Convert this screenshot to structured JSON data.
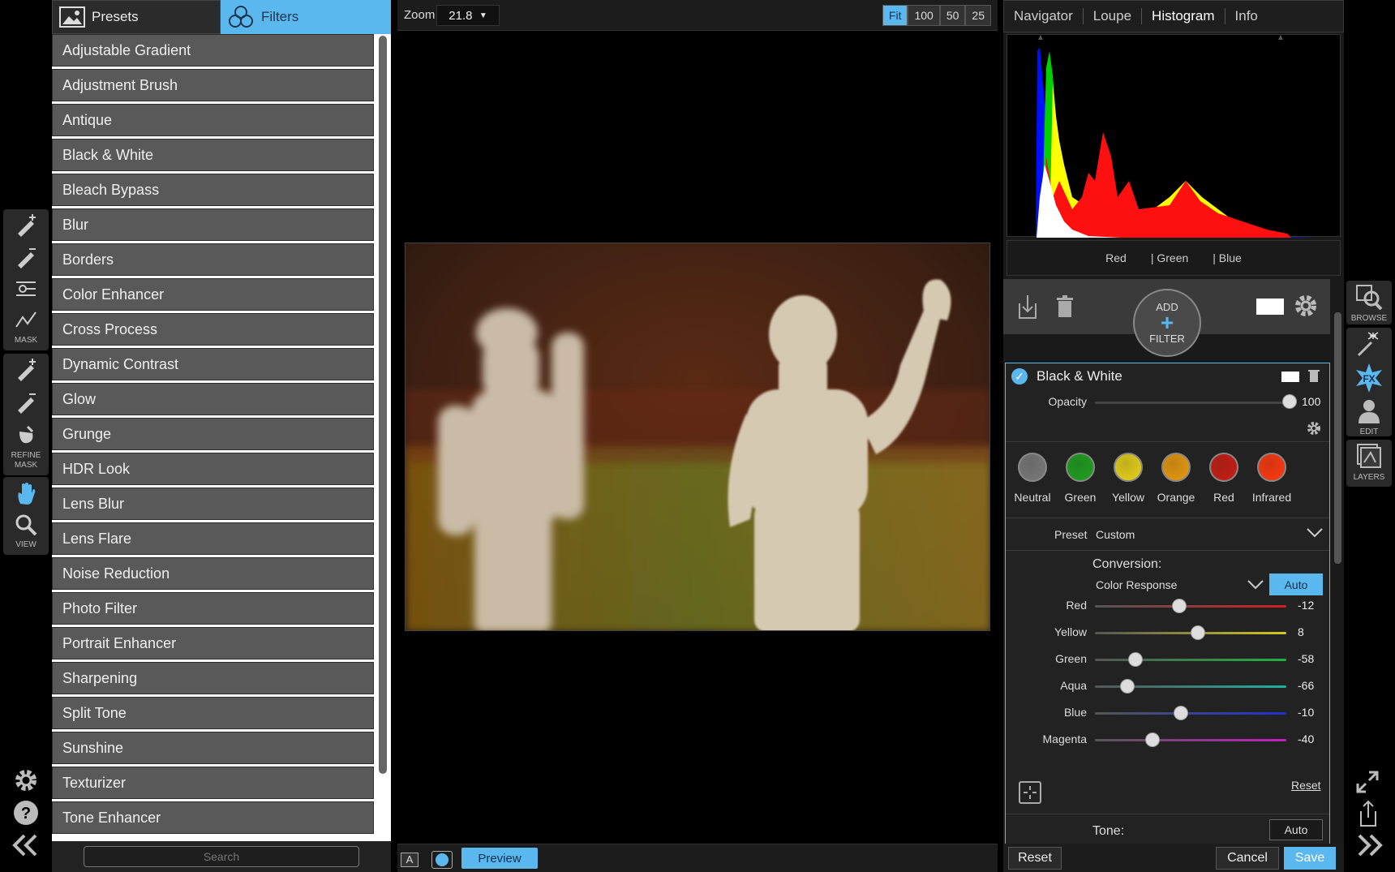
{
  "tabs": {
    "presets": "Presets",
    "filters": "Filters"
  },
  "left_tools": {
    "mask": "MASK",
    "refine_mask_1": "REFINE",
    "refine_mask_2": "MASK",
    "view": "VIEW"
  },
  "filters": [
    "Adjustable Gradient",
    "Adjustment Brush",
    "Antique",
    "Black & White",
    "Bleach Bypass",
    "Blur",
    "Borders",
    "Color Enhancer",
    "Cross Process",
    "Dynamic Contrast",
    "Glow",
    "Grunge",
    "HDR Look",
    "Lens Blur",
    "Lens Flare",
    "Noise Reduction",
    "Photo Filter",
    "Portrait Enhancer",
    "Sharpening",
    "Split Tone",
    "Sunshine",
    "Texturizer",
    "Tone Enhancer"
  ],
  "search": {
    "placeholder": "Search"
  },
  "zoom": {
    "label": "Zoom",
    "value": "21.8",
    "buttons": [
      "Fit",
      "100",
      "50",
      "25"
    ],
    "active": "Fit"
  },
  "bottom": {
    "preview": "Preview",
    "mode_a": "A"
  },
  "right_tabs": [
    "Navigator",
    "Loupe",
    "Histogram",
    "Info"
  ],
  "right_tab_active": "Histogram",
  "histogram_legend": [
    "Red",
    "| Green",
    "| Blue"
  ],
  "add_filter": {
    "line1": "ADD",
    "plus": "+",
    "line2": "FILTER"
  },
  "filter_panel": {
    "title": "Black & White",
    "opacity_label": "Opacity",
    "opacity_value": "100",
    "opacity_level": 1.0,
    "swatches": [
      {
        "label": "Neutral",
        "color": "#7a7a7a"
      },
      {
        "label": "Green",
        "color": "#1fa01f"
      },
      {
        "label": "Yellow",
        "color": "#e8d21a"
      },
      {
        "label": "Orange",
        "color": "#e89a10"
      },
      {
        "label": "Red",
        "color": "#c81e14"
      },
      {
        "label": "Infrared",
        "color": "#ff3a10"
      }
    ],
    "preset_label": "Preset",
    "preset_value": "Custom",
    "conversion_label": "Conversion:",
    "conversion_mode": "Color Response",
    "auto_label": "Auto",
    "sliders": [
      {
        "label": "Red",
        "value": "-12",
        "level": 0.44,
        "color": "#d02020"
      },
      {
        "label": "Yellow",
        "value": "8",
        "level": 0.54,
        "color": "#d0c820"
      },
      {
        "label": "Green",
        "value": "-58",
        "level": 0.21,
        "color": "#20b040"
      },
      {
        "label": "Aqua",
        "value": "-66",
        "level": 0.17,
        "color": "#20b0a0"
      },
      {
        "label": "Blue",
        "value": "-10",
        "level": 0.45,
        "color": "#2030d0"
      },
      {
        "label": "Magenta",
        "value": "-40",
        "level": 0.3,
        "color": "#c020c0"
      }
    ],
    "reset_link": "Reset",
    "tone_label": "Tone:",
    "tone_auto": "Auto"
  },
  "right_strip": {
    "browse": "BROWSE",
    "edit": "EDIT",
    "layers": "LAYERS"
  },
  "buttons": {
    "reset": "Reset",
    "cancel": "Cancel",
    "save": "Save"
  },
  "colors": {
    "accent": "#5bb8ee"
  }
}
